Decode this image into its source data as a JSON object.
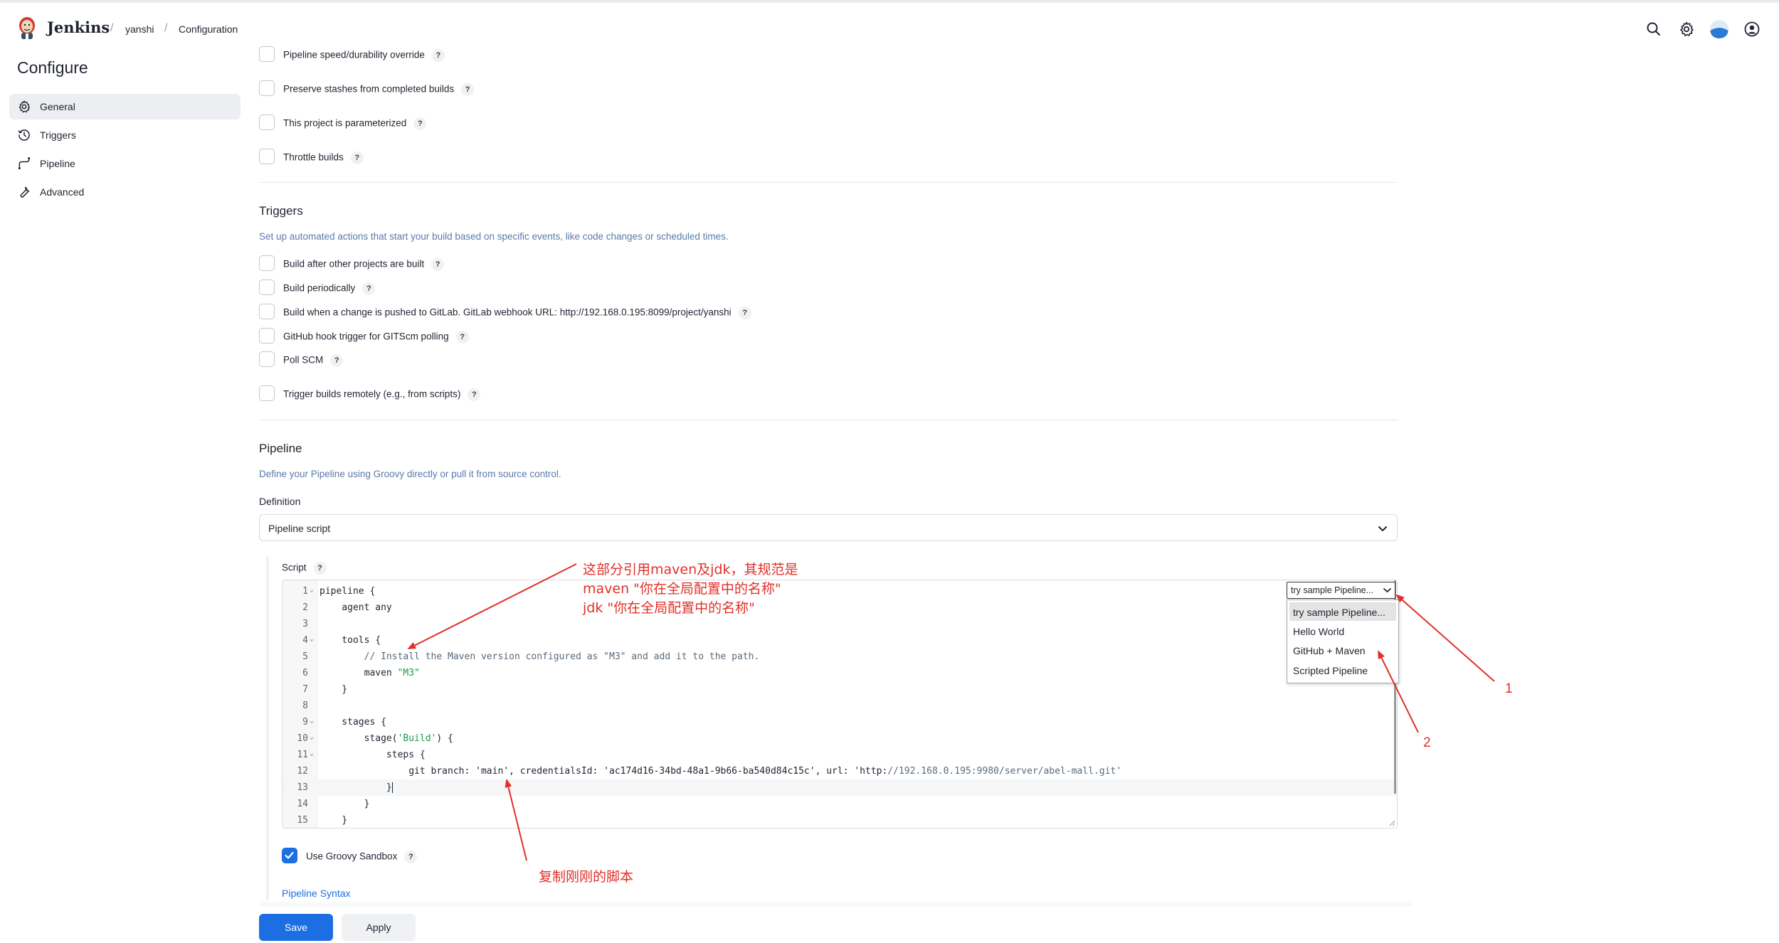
{
  "header": {
    "brand": "Jenkins",
    "breadcrumbs": [
      "yanshi",
      "Configuration"
    ],
    "icons": [
      "search-icon",
      "gear-icon",
      "weather-icon",
      "user-icon"
    ]
  },
  "sidebar": {
    "title": "Configure",
    "items": [
      {
        "label": "General",
        "icon": "gear-icon",
        "active": true
      },
      {
        "label": "Triggers",
        "icon": "clock-icon",
        "active": false
      },
      {
        "label": "Pipeline",
        "icon": "pipeline-icon",
        "active": false
      },
      {
        "label": "Advanced",
        "icon": "wrench-icon",
        "active": false
      }
    ]
  },
  "general_options": [
    {
      "label": "Pipeline speed/durability override",
      "checked": false
    },
    {
      "label": "Preserve stashes from completed builds",
      "checked": false
    },
    {
      "label": "This project is parameterized",
      "checked": false
    },
    {
      "label": "Throttle builds",
      "checked": false
    }
  ],
  "triggers": {
    "title": "Triggers",
    "description": "Set up automated actions that start your build based on specific events, like code changes or scheduled times.",
    "options": [
      {
        "label": "Build after other projects are built",
        "checked": false
      },
      {
        "label": "Build periodically",
        "checked": false
      },
      {
        "label": "Build when a change is pushed to GitLab. GitLab webhook URL: http://192.168.0.195:8099/project/yanshi",
        "checked": false
      },
      {
        "label": "GitHub hook trigger for GITScm polling",
        "checked": false
      },
      {
        "label": "Poll SCM",
        "checked": false
      },
      {
        "label": "Trigger builds remotely (e.g., from scripts)",
        "checked": false
      }
    ]
  },
  "pipeline": {
    "title": "Pipeline",
    "description": "Define your Pipeline using Groovy directly or pull it from source control.",
    "definition_label": "Definition",
    "definition_value": "Pipeline script",
    "script_label": "Script",
    "code_lines": [
      {
        "n": "1",
        "fold": true,
        "text": "pipeline {"
      },
      {
        "n": "2",
        "fold": false,
        "text": "    agent any"
      },
      {
        "n": "3",
        "fold": false,
        "text": ""
      },
      {
        "n": "4",
        "fold": true,
        "text": "    tools {"
      },
      {
        "n": "5",
        "fold": false,
        "text": "        // Install the Maven version configured as \"M3\" and add it to the path."
      },
      {
        "n": "6",
        "fold": false,
        "text": "        maven \"M3\""
      },
      {
        "n": "7",
        "fold": false,
        "text": "    }"
      },
      {
        "n": "8",
        "fold": false,
        "text": ""
      },
      {
        "n": "9",
        "fold": true,
        "text": "    stages {"
      },
      {
        "n": "10",
        "fold": true,
        "text": "        stage('Build') {"
      },
      {
        "n": "11",
        "fold": true,
        "text": "            steps {"
      },
      {
        "n": "12",
        "fold": false,
        "text": "                git branch: 'main', credentialsId: 'ac174d16-34bd-48a1-9b66-ba540d84c15c', url: 'http://192.168.0.195:9980/server/abel-mall.git'"
      },
      {
        "n": "13",
        "fold": false,
        "text": "            }"
      },
      {
        "n": "14",
        "fold": false,
        "text": "        }"
      },
      {
        "n": "15",
        "fold": false,
        "text": "    }"
      }
    ],
    "sample_select": {
      "value": "try sample Pipeline...",
      "options": [
        "try sample Pipeline...",
        "Hello World",
        "GitHub + Maven",
        "Scripted Pipeline"
      ]
    },
    "sandbox_label": "Use Groovy Sandbox",
    "sandbox_checked": true,
    "syntax_link": "Pipeline Syntax"
  },
  "buttons": {
    "save": "Save",
    "apply": "Apply"
  },
  "annotations": {
    "tools_note_line1": "这部分引用maven及jdk，其规范是",
    "tools_note_line2": "maven \"你在全局配置中的名称\"",
    "tools_note_line3": "jdk \"你在全局配置中的名称\"",
    "copy_note": "复制刚刚的脚本",
    "num1": "1",
    "num2": "2"
  },
  "colors": {
    "accent": "#1c6fe3",
    "annotation": "#e0302a",
    "string": "#1b9c46"
  }
}
